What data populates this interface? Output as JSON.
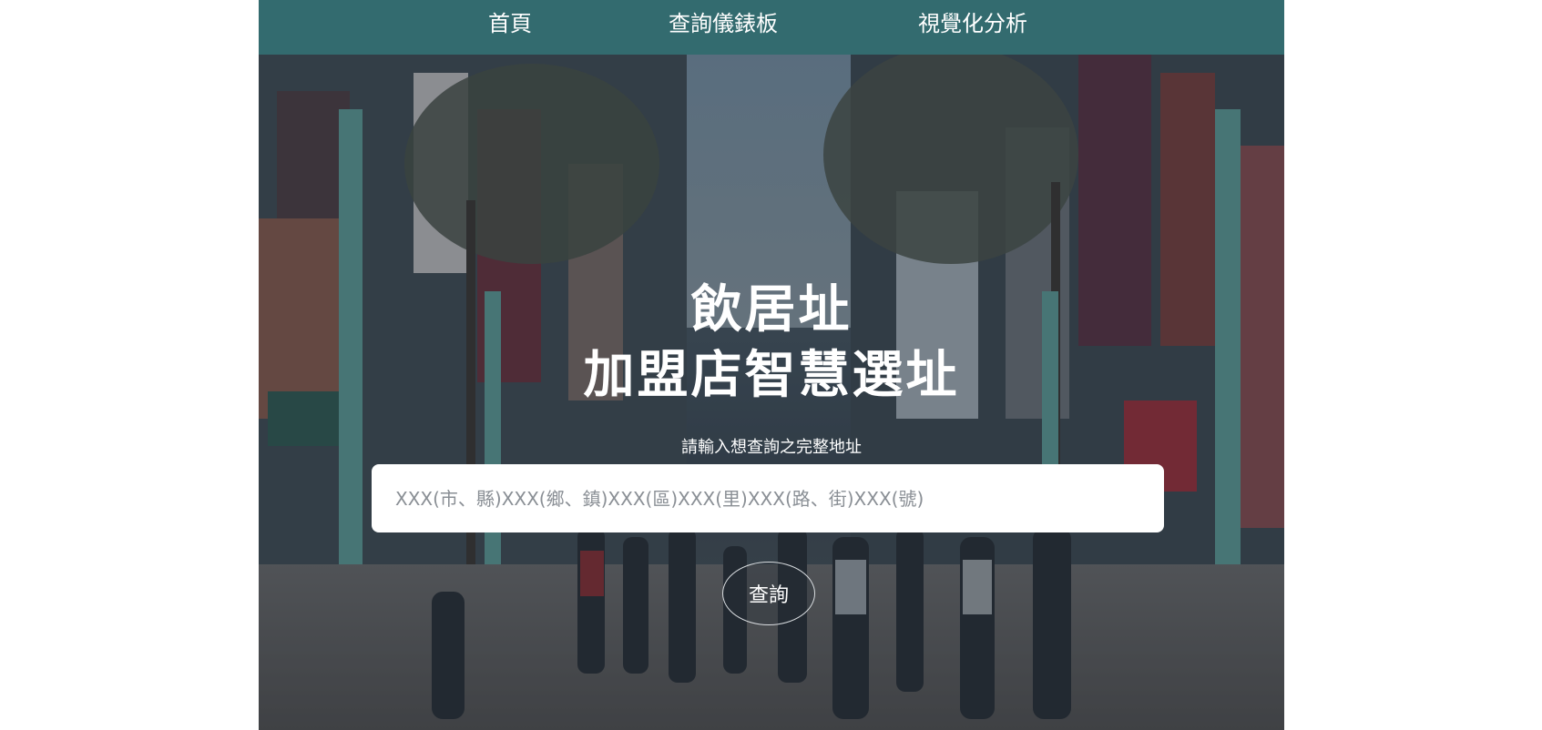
{
  "nav": {
    "items": [
      {
        "label": "首頁"
      },
      {
        "label": "查詢儀錶板"
      },
      {
        "label": "視覺化分析"
      }
    ]
  },
  "hero": {
    "title_line1": "飲居址",
    "title_line2": "加盟店智慧選址",
    "prompt": "請輸入想查詢之完整地址",
    "search_placeholder": "XXX(市、縣)XXX(鄉、鎮)XXX(區)XXX(里)XXX(路、街)XXX(號)",
    "search_value": "",
    "button_label": "查詢",
    "background": "street-photo"
  },
  "colors": {
    "navbar": "#336b6f",
    "accent_pillar": "#5e9e98",
    "text_light": "#ffffff"
  }
}
